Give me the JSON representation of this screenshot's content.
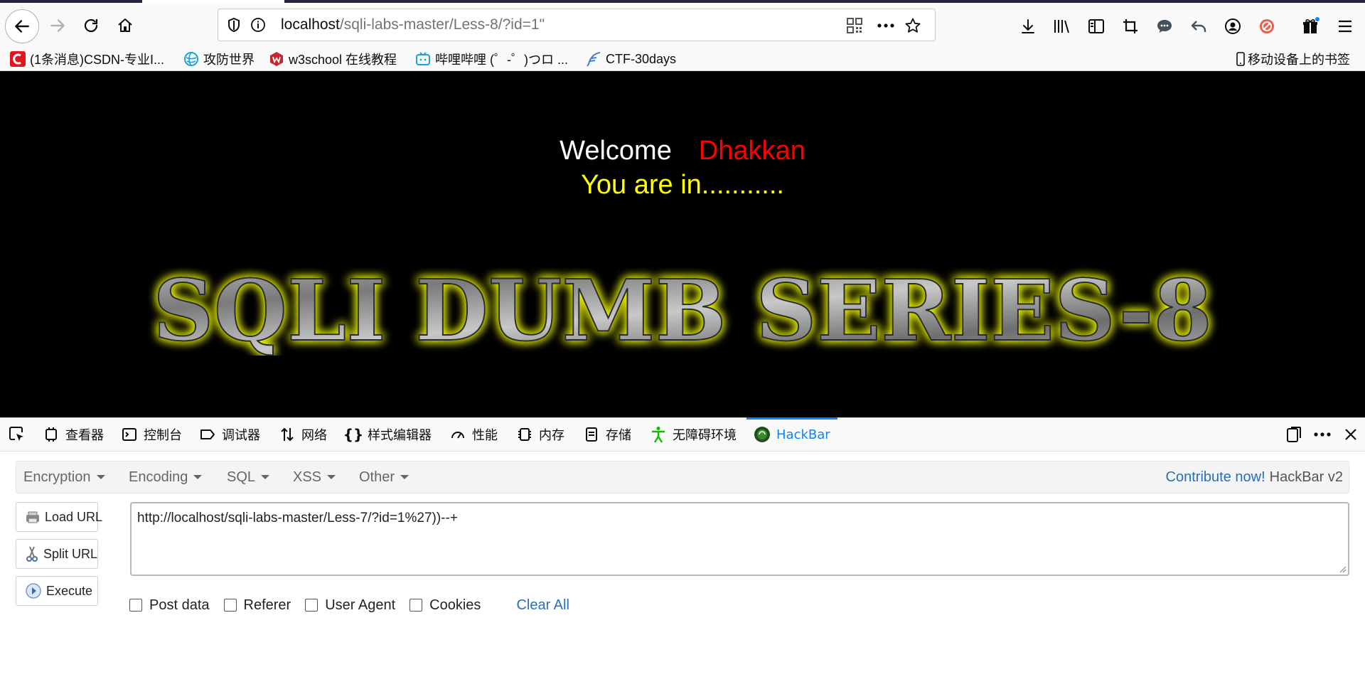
{
  "browser": {
    "url_host": "localhost",
    "url_path": "/sqli-labs-master/Less-8/?id=1\"",
    "bookmarks": [
      {
        "label": "(1条消息)CSDN-专业I..."
      },
      {
        "label": "攻防世界"
      },
      {
        "label": "w3school 在线教程"
      },
      {
        "label": "哔哩哔哩 (゜-゜)つロ ..."
      },
      {
        "label": "CTF-30days"
      }
    ],
    "mobile_bookmarks": "移动设备上的书签"
  },
  "page": {
    "welcome": "Welcome",
    "user": "Dhakkan",
    "status": "You are in...........",
    "banner": "SQLI DUMB SERIES-8"
  },
  "devtools": {
    "tabs": [
      {
        "label": "查看器",
        "icon": "inspector-icon"
      },
      {
        "label": "控制台",
        "icon": "console-icon"
      },
      {
        "label": "调试器",
        "icon": "debugger-icon"
      },
      {
        "label": "网络",
        "icon": "network-icon"
      },
      {
        "label": "样式编辑器",
        "icon": "style-editor-icon"
      },
      {
        "label": "性能",
        "icon": "performance-icon"
      },
      {
        "label": "内存",
        "icon": "memory-icon"
      },
      {
        "label": "存储",
        "icon": "storage-icon"
      },
      {
        "label": "无障碍环境",
        "icon": "accessibility-icon"
      },
      {
        "label": "HackBar",
        "icon": "hackbar-icon",
        "active": true
      }
    ]
  },
  "hackbar": {
    "menus": [
      "Encryption",
      "Encoding",
      "SQL",
      "XSS",
      "Other"
    ],
    "contribute": "Contribute now!",
    "version": "HackBar v2",
    "load_url": "Load URL",
    "split_url": "Split URL",
    "execute": "Execute",
    "url_value": "http://localhost/sqli-labs-master/Less-7/?id=1%27))--+",
    "post_data": "Post data",
    "referer": "Referer",
    "user_agent": "User Agent",
    "cookies": "Cookies",
    "clear_all": "Clear All"
  },
  "colors": {
    "accent": "#0a84ff",
    "welcome_user": "#ff0000",
    "status": "#ffff00",
    "banner_glow": "#e8f000",
    "link": "#2a6ebb"
  }
}
